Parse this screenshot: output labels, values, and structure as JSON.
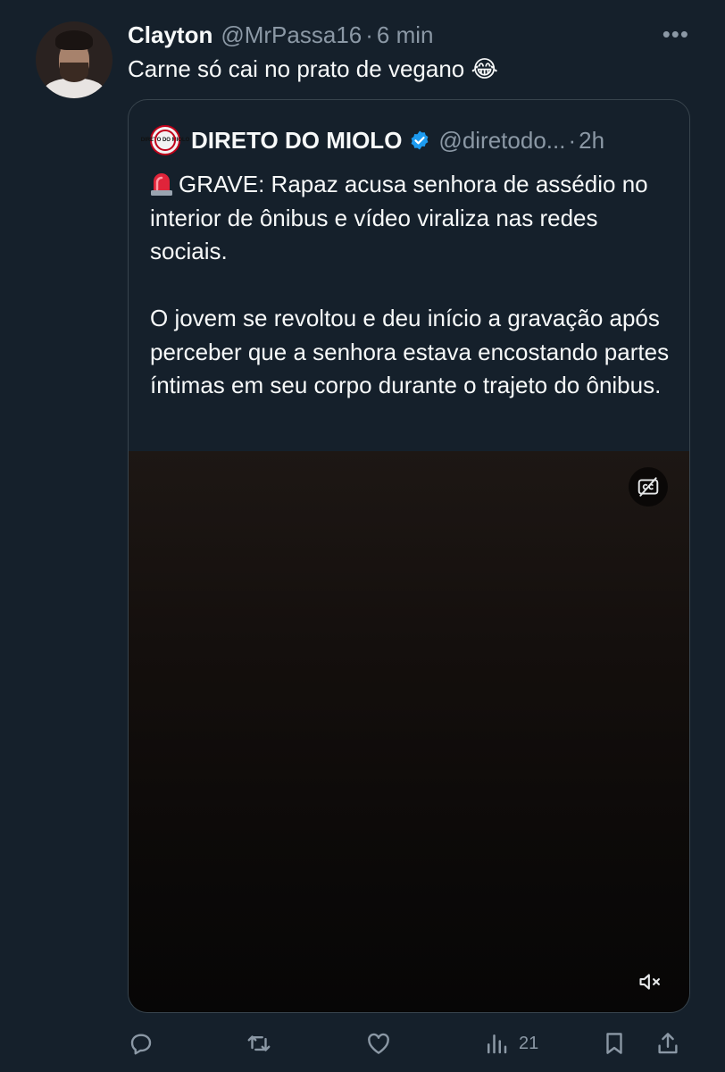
{
  "tweet": {
    "author_name": "Clayton",
    "handle": "@MrPassa16",
    "separator": "·",
    "time": "6 min",
    "more_label": "•••",
    "text": "Carne só cai no prato de vegano 😂"
  },
  "quote": {
    "logo_text": "DIRETO DO MIOLO",
    "author_name": "DIRETO DO MIOLO",
    "handle": "@diretodo...",
    "separator": "·",
    "time": "2h",
    "paragraph_1": "GRAVE: Rapaz acusa senhora de assédio no interior de ônibus e vídeo viraliza nas redes sociais.",
    "paragraph_2": "O jovem se revoltou e deu início a gravação após perceber que a senhora estava encostando partes íntimas em seu corpo durante o trajeto do ônibus."
  },
  "video": {
    "captions_icon": "captions-off-icon",
    "mute_icon": "muted-speaker-icon"
  },
  "actions": {
    "reply_icon": "reply-icon",
    "retweet_icon": "retweet-icon",
    "like_icon": "heart-icon",
    "views_icon": "views-icon",
    "views_count": "21",
    "bookmark_icon": "bookmark-icon",
    "share_icon": "share-icon"
  },
  "colors": {
    "background": "#15202b",
    "text": "#f7f9f9",
    "secondary_text": "#8b98a5",
    "border": "#38444d",
    "verified": "#1d9bf0"
  }
}
